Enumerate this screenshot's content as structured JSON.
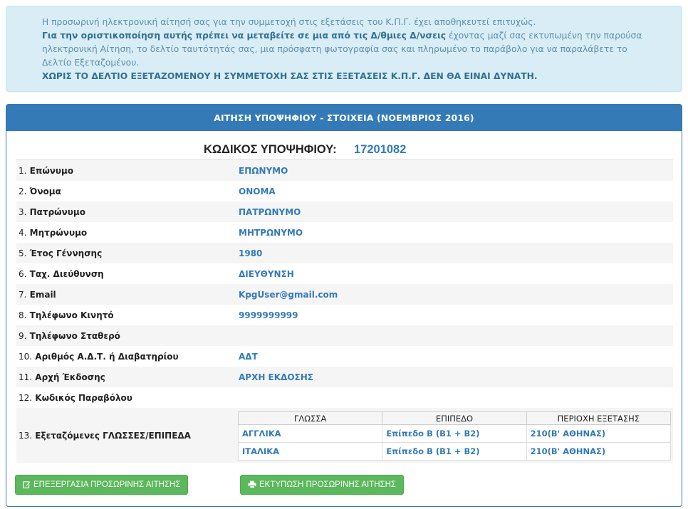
{
  "alert": {
    "line1": "Η προσωρινή ηλεκτρονική αίτησή σας για την συμμετοχή στις εξετάσεις του Κ.Π.Γ. έχει αποθηκευτεί επιτυχώς.",
    "line2_bold": "Για την οριστικοποίηση αυτής πρέπει να μεταβείτε σε μια από τις Δ/θμιες Δ/νσεις",
    "line2_rest": " έχοντας μαζί σας εκτυπωμένη την παρούσα ηλεκτρονική Αίτηση, το δελτίο ταυτότητάς σας, μια πρόσφατη φωτογραφία σας και πληρωμένο το παράβολο για να παραλάβετε το Δελτίο Εξεταζομένου.",
    "warning": "ΧΩΡΙΣ ΤΟ ΔΕΛΤΙΟ ΕΞΕΤΑΖΟΜΕΝΟΥ Η ΣΥΜΜΕΤΟΧΗ ΣΑΣ ΣΤΙΣ ΕΞΕΤΑΣΕΙΣ Κ.Π.Γ. ΔΕΝ ΘΑ ΕΙΝΑΙ ΔΥΝΑΤΗ."
  },
  "panel": {
    "heading": "ΑΙΤΗΣΗ ΥΠΟΨΗΦΙΟΥ - ΣΤΟΙΧΕΙΑ (ΝΟΕΜΒΡΙΟΣ 2016)",
    "code_label": "ΚΩΔΙΚΟΣ ΥΠΟΨΗΦΙΟΥ:",
    "code_value": "17201082"
  },
  "fields": [
    {
      "num": "1.",
      "label": "Επώνυμο",
      "value": "ΕΠΩΝΥΜΟ"
    },
    {
      "num": "2.",
      "label": "Όνομα",
      "value": "ΟΝΟΜΑ"
    },
    {
      "num": "3.",
      "label": "Πατρώνυμο",
      "value": "ΠΑΤΡΩΝΥΜΟ"
    },
    {
      "num": "4.",
      "label": "Μητρώνυμο",
      "value": "ΜΗΤΡΩΝΥΜΟ"
    },
    {
      "num": "5.",
      "label": "Έτος Γέννησης",
      "value": "1980"
    },
    {
      "num": "6.",
      "label": "Ταχ. Διεύθυνση",
      "value": "ΔΙΕΥΘΥΝΣΗ"
    },
    {
      "num": "7.",
      "label": "Email",
      "value": "KpgUser@gmail.com"
    },
    {
      "num": "8.",
      "label": "Τηλέφωνο Κινητό",
      "value": "9999999999"
    },
    {
      "num": "9.",
      "label": "Τηλέφωνο Σταθερό",
      "value": ""
    },
    {
      "num": "10.",
      "label": "Αριθμός Α.Δ.Τ. ή Διαβατηρίου",
      "value": "ΑΔΤ"
    },
    {
      "num": "11.",
      "label": "Αρχή Έκδοσης",
      "value": "ΑΡΧΗ ΕΚΔΟΣΗΣ"
    },
    {
      "num": "12.",
      "label": "Κωδικός Παραβόλου",
      "value": ""
    }
  ],
  "languages": {
    "num": "13.",
    "label": "Εξεταζόμενες ΓΛΩΣΣΕΣ/ΕΠΙΠΕΔΑ",
    "headers": [
      "ΓΛΩΣΣΑ",
      "ΕΠΙΠΕΔΟ",
      "ΠΕΡΙΟΧΗ ΕΞΕΤΑΣΗΣ"
    ],
    "rows": [
      [
        "ΑΓΓΛΙΚΑ",
        "Επίπεδο Β (Β1 + Β2)",
        "210(Β' ΑΘΗΝΑΣ)"
      ],
      [
        "ΙΤΑΛΙΚΑ",
        "Επίπεδο Β (Β1 + Β2)",
        "210(Β' ΑΘΗΝΑΣ)"
      ]
    ]
  },
  "buttons": {
    "edit_label": "ΕΠΕΞΕΡΓΑΣΙΑ ΠΡΟΣΩΡΙΝΗΣ ΑΙΤΗΣΗΣ",
    "print_label": "ΕΚΤΥΠΩΣΗ ΠΡΟΣΩΡΙΝΗΣ ΑΙΤΗΣΗΣ",
    "edit_icon": "edit-icon",
    "print_icon": "print-icon"
  }
}
